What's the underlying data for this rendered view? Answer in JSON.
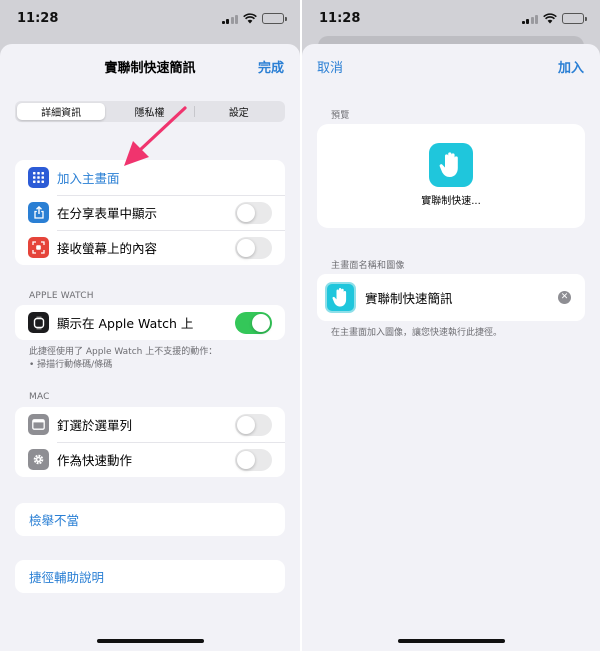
{
  "status": {
    "time": "11:28"
  },
  "left": {
    "nav": {
      "title": "實聯制快速簡訊",
      "done_label": "完成"
    },
    "segments": [
      "詳細資訊",
      "隱私權",
      "設定"
    ],
    "group1": [
      {
        "label": "加入主畫面",
        "icon": "home-screen-grid-icon",
        "icon_color": "#2c5bd6"
      },
      {
        "label": "在分享表單中顯示",
        "icon": "share-icon",
        "icon_color": "#2a7fd4",
        "toggle": false
      },
      {
        "label": "接收螢幕上的內容",
        "icon": "screen-capture-icon",
        "icon_color": "#e5443a",
        "toggle": false
      }
    ],
    "apple_watch": {
      "header": "APPLE WATCH",
      "row": {
        "label": "顯示在 Apple Watch 上",
        "icon": "apple-watch-icon",
        "toggle": true
      },
      "footnote_lines": [
        "此捷徑使用了 Apple Watch 上不支援的動作：",
        "• 掃描行動條碼/條碼"
      ]
    },
    "mac": {
      "header": "MAC",
      "rows": [
        {
          "label": "釘選於選單列",
          "icon": "menu-bar-icon",
          "toggle": false
        },
        {
          "label": "作為快速動作",
          "icon": "gear-icon",
          "toggle": false
        }
      ]
    },
    "report_label": "檢舉不當",
    "help_label": "捷徑輔助說明"
  },
  "right": {
    "nav": {
      "cancel_label": "取消",
      "add_label": "加入"
    },
    "preview_header": "預覽",
    "preview_name": "實聯制快速...",
    "name_header": "主畫面名稱和圖像",
    "name_value": "實聯制快速簡訊",
    "footnote": "在主畫面加入圖像，讓您快速執行此捷徑。"
  },
  "colors": {
    "accent": "#2a7fd4",
    "toggle_on": "#34c759",
    "annotation_arrow": "#f0346e",
    "shortcut_icon": "#1fc6dc"
  }
}
